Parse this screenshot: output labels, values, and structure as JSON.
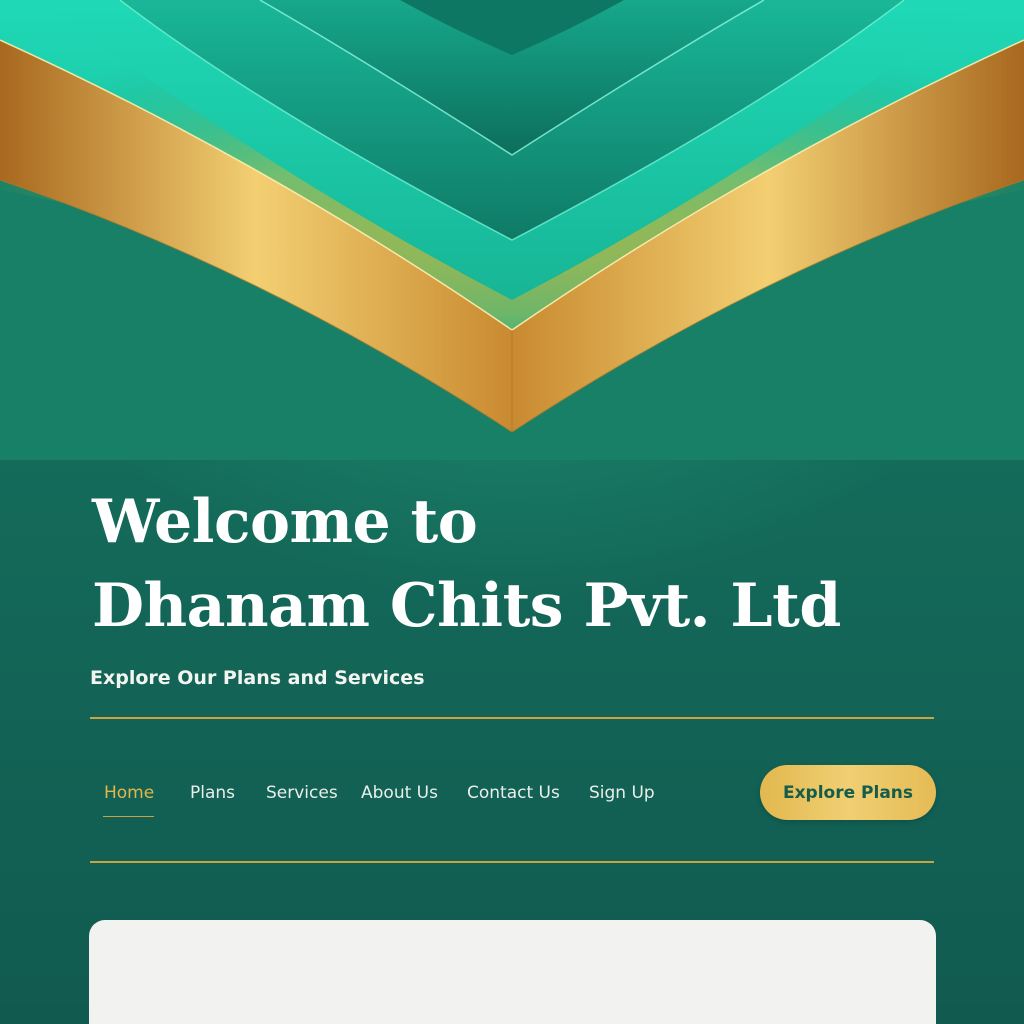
{
  "hero": {
    "title_line1": "Welcome to",
    "title_line2": "Dhanam Chits Pvt. Ltd",
    "subtitle": "Explore Our Plans and Services"
  },
  "nav": {
    "items": [
      {
        "label": "Home",
        "active": true
      },
      {
        "label": "Plans",
        "active": false
      },
      {
        "label": "Services",
        "active": false
      },
      {
        "label": "About Us",
        "active": false
      },
      {
        "label": "Contact Us",
        "active": false
      },
      {
        "label": "Sign Up",
        "active": false
      }
    ],
    "cta_label": "Explore Plans"
  },
  "colors": {
    "background": "#135c52",
    "teal_accent": "#1fd2b0",
    "gold_accent": "#e3b64a",
    "text_primary": "#ffffff"
  }
}
